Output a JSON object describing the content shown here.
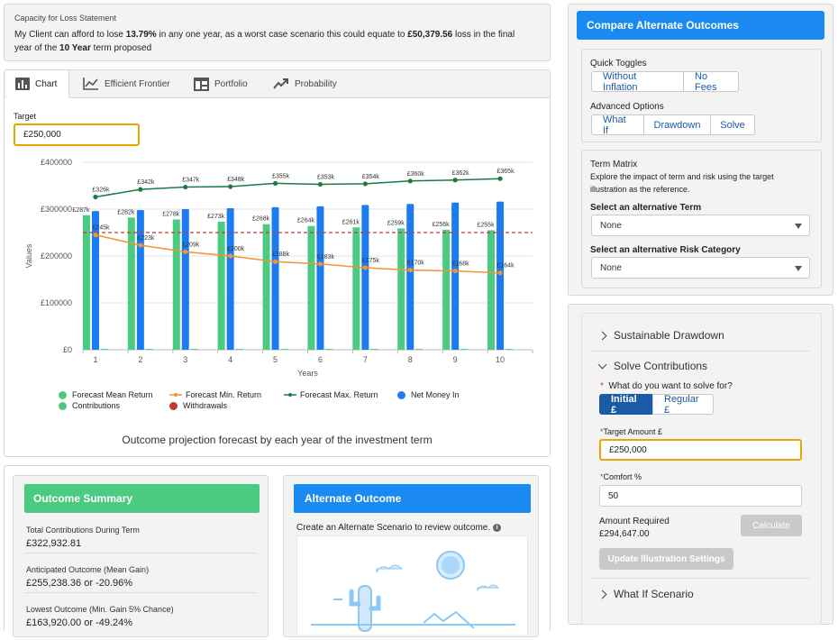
{
  "loss_statement": {
    "title": "Capacity for Loss Statement",
    "text_1": "My Client can afford to lose ",
    "pct": "13.79%",
    "text_2": " in any one year, as a worst case scenario this could equate to ",
    "amount": "£50,379.56",
    "text_3": " loss in the final",
    "text_4": "year of the ",
    "term": "10 Year",
    "text_5": " term proposed"
  },
  "tabs": [
    {
      "label": "Chart",
      "icon": "bar-chart-icon",
      "active": true
    },
    {
      "label": "Efficient Frontier",
      "icon": "line-chart-icon"
    },
    {
      "label": "Portfolio",
      "icon": "portfolio-icon"
    },
    {
      "label": "Probability",
      "icon": "trend-icon"
    }
  ],
  "target": {
    "label": "Target",
    "value": "£250,000"
  },
  "chart_caption": "Outcome projection forecast by each year of the investment term",
  "chart_data": {
    "type": "bar",
    "xlabel": "Years",
    "ylabel": "Values",
    "categories": [
      "1",
      "2",
      "3",
      "4",
      "5",
      "6",
      "7",
      "8",
      "9",
      "10"
    ],
    "ylim": [
      0,
      400000
    ],
    "yticks": [
      "£0",
      "£100000",
      "£200000",
      "£300000",
      "£400000"
    ],
    "target_line": 250000,
    "series": [
      {
        "name": "Forecast Mean Return",
        "kind": "bar",
        "color": "#4bca81",
        "values": [
          287000,
          282000,
          278000,
          273000,
          268000,
          264000,
          261000,
          259000,
          256000,
          255000
        ],
        "labels": [
          "£287k",
          "£282k",
          "£278k",
          "£273k",
          "£268k",
          "£264k",
          "£261k",
          "£259k",
          "£256k",
          "£255k"
        ]
      },
      {
        "name": "Net Money In",
        "kind": "bar",
        "color": "#1b7cf2",
        "values": [
          296000,
          298000,
          300000,
          302000,
          304000,
          306000,
          309000,
          311000,
          314000,
          316000
        ]
      },
      {
        "name": "Contributions",
        "kind": "bar",
        "color": "#5fd3a0",
        "values": [
          2000,
          2000,
          2000,
          2000,
          2000,
          2000,
          2000,
          2000,
          2000,
          2000
        ]
      },
      {
        "name": "Withdrawals",
        "kind": "bar",
        "color": "#c23934",
        "values": [
          0,
          0,
          0,
          0,
          0,
          0,
          0,
          0,
          0,
          0
        ]
      },
      {
        "name": "Forecast Min. Return",
        "kind": "line",
        "color": "#f59331",
        "values": [
          245000,
          223000,
          209000,
          200000,
          188000,
          183000,
          175000,
          170000,
          168000,
          164000
        ],
        "labels": [
          "£245k",
          "£223k",
          "£209k",
          "£200k",
          "£188k",
          "£183k",
          "£175k",
          "£170k",
          "£168k",
          "£164k"
        ]
      },
      {
        "name": "Forecast Max. Return",
        "kind": "line",
        "color": "#1b7a44",
        "values": [
          326000,
          342000,
          347000,
          348000,
          355000,
          353000,
          354000,
          360000,
          362000,
          365000
        ],
        "labels": [
          "£326k",
          "£342k",
          "£347k",
          "£348k",
          "£355k",
          "£353k",
          "£354k",
          "£360k",
          "£362k",
          "£365k"
        ]
      }
    ],
    "legend": [
      {
        "name": "Forecast Mean Return",
        "color": "#4bca81",
        "marker": "dot"
      },
      {
        "name": "Forecast Min. Return",
        "color": "#f59331",
        "marker": "line"
      },
      {
        "name": "Forecast Max. Return",
        "color": "#1b7a44",
        "marker": "line"
      },
      {
        "name": "Net Money In",
        "color": "#1b7cf2",
        "marker": "dot"
      },
      {
        "name": "Contributions",
        "color": "#4bca81",
        "marker": "dot"
      },
      {
        "name": "Withdrawals",
        "color": "#c23934",
        "marker": "dot"
      }
    ]
  },
  "outcome_summary": {
    "title": "Outcome Summary",
    "color": "#4bca81",
    "stats": [
      {
        "label": "Total Contributions During Term",
        "value": "£322,932.81"
      },
      {
        "label": "Anticipated Outcome (Mean Gain)",
        "value": "£255,238.36 or -20.96%"
      },
      {
        "label": "Lowest Outcome (Min. Gain 5% Chance)",
        "value": "£163,920.00 or -49.24%"
      }
    ]
  },
  "alternate_outcome": {
    "title": "Alternate Outcome",
    "color": "#1b8af0",
    "subtitle": "Create an Alternate Scenario to review outcome."
  },
  "compare": {
    "title": "Compare Alternate Outcomes",
    "color": "#1b8af0",
    "quick_toggles_label": "Quick Toggles",
    "quick_toggles": [
      "Without Inflation",
      "No Fees"
    ],
    "advanced_label": "Advanced Options",
    "advanced": [
      "What If",
      "Drawdown",
      "Solve"
    ],
    "term_matrix_title": "Term Matrix",
    "term_matrix_desc_1": "Explore the impact of term and risk using the target",
    "term_matrix_desc_2": "illustration as the reference.",
    "alt_term_label": "Select an alternative Term",
    "alt_term_value": "None",
    "alt_risk_label": "Select an alternative Risk Category",
    "alt_risk_value": "None"
  },
  "accordion": {
    "sustainable": "Sustainable Drawdown",
    "solve": "Solve Contributions",
    "solve_question": "What do you want to solve for?",
    "solve_options": [
      "Initial £",
      "Regular £"
    ],
    "target_amount_label": "Target Amount £",
    "target_amount_value": "£250,000",
    "comfort_label": "Comfort %",
    "comfort_value": "50",
    "amount_required_label": "Amount Required",
    "amount_required_value": "£294,647.00",
    "calculate": "Calculate",
    "update": "Update Illustration Settings",
    "whatif": "What If Scenario"
  }
}
